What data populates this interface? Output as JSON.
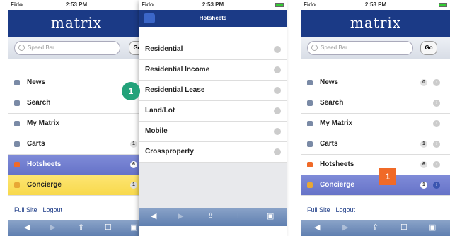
{
  "status": {
    "carrier": "Fido",
    "time": "2:53 PM"
  },
  "brand": "matrix",
  "search": {
    "placeholder": "Speed Bar",
    "go": "Go"
  },
  "menu": [
    {
      "label": "News",
      "badge": "0"
    },
    {
      "label": "Search"
    },
    {
      "label": "My Matrix"
    },
    {
      "label": "Carts",
      "badge": "1"
    },
    {
      "label": "Hotsheets",
      "badge": "6"
    },
    {
      "label": "Concierge",
      "badge": "1"
    }
  ],
  "footer": {
    "full_site": "Full Site",
    "sep": " · ",
    "logout": "Logout"
  },
  "overlay": {
    "title": "Hotsheets",
    "items": [
      "Residential",
      "Residential Income",
      "Residential Lease",
      "Land/Lot",
      "Mobile",
      "Crossproperty"
    ]
  },
  "markers": {
    "green": "1",
    "orange": "1"
  },
  "colors": {
    "brand": "#1b3a86",
    "selected": "#6673c8",
    "concierge": "#f8d94c",
    "marker_green": "#23a27a",
    "marker_orange": "#f06a28"
  }
}
